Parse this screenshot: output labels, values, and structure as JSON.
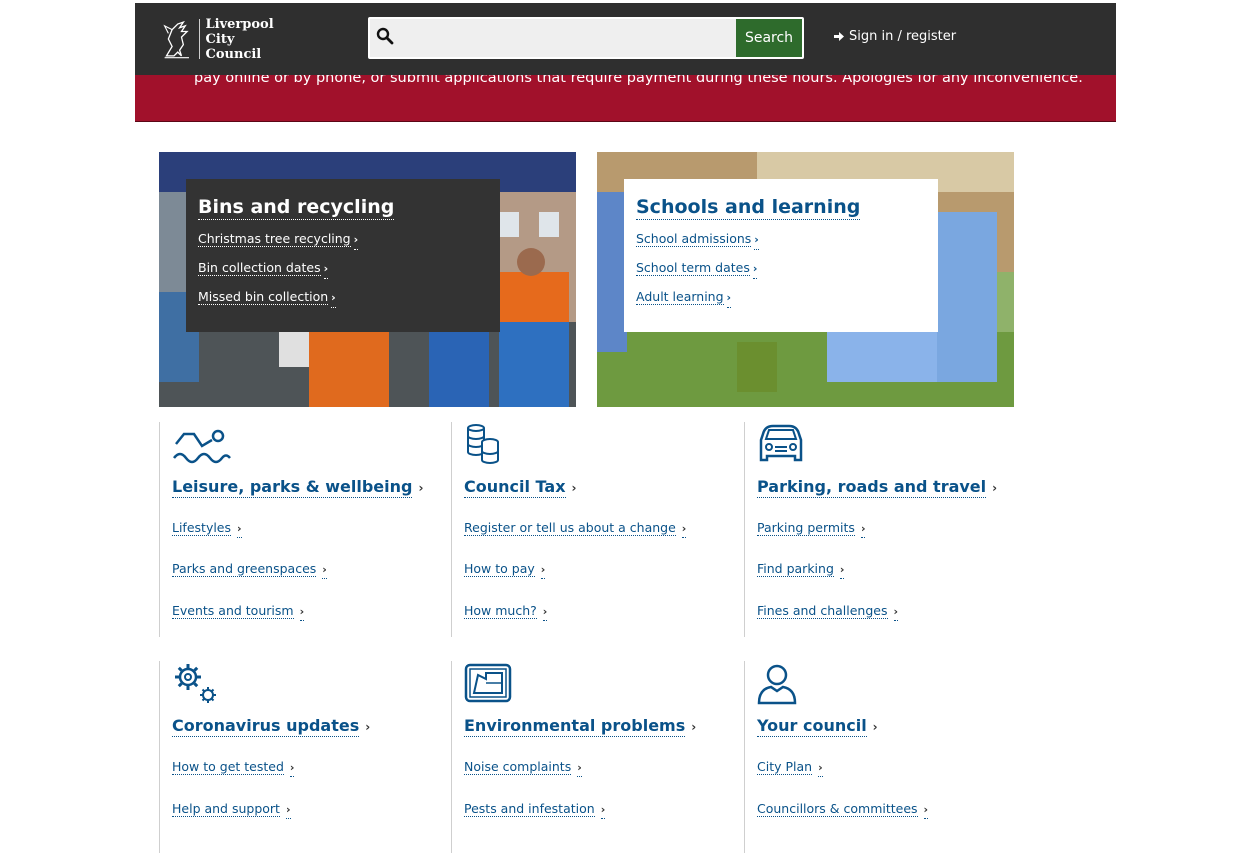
{
  "header": {
    "logo_line1": "Liverpool",
    "logo_line2": "City Council",
    "search_placeholder": "",
    "search_button": "Search",
    "signin_label": "Sign in / register"
  },
  "alert": {
    "text": "pay online or by phone, or submit applications that require payment during these hours. Apologies for any inconvenience."
  },
  "features": {
    "bins": {
      "title": "Bins and recycling",
      "links": [
        "Christmas tree recycling",
        "Bin collection dates",
        "Missed bin collection"
      ]
    },
    "schools": {
      "title": "Schools and learning",
      "links": [
        "School admissions",
        "School term dates",
        "Adult learning"
      ]
    }
  },
  "categories": [
    {
      "title": "Leisure, parks & wellbeing",
      "icon": "swimmer-icon",
      "links": [
        "Lifestyles",
        "Parks and greenspaces",
        "Events and tourism"
      ]
    },
    {
      "title": "Council Tax",
      "icon": "coins-icon",
      "links": [
        "Register or tell us about a change",
        "How to pay",
        "How much?"
      ]
    },
    {
      "title": "Parking, roads and travel",
      "icon": "car-icon",
      "links": [
        "Parking permits",
        "Find parking",
        "Fines and challenges"
      ]
    },
    {
      "title": "Coronavirus updates",
      "icon": "gears-icon",
      "links": [
        "How to get tested",
        "Help and support"
      ]
    },
    {
      "title": "Environmental problems",
      "icon": "environment-icon",
      "links": [
        "Noise complaints",
        "Pests and infestation"
      ]
    },
    {
      "title": "Your council",
      "icon": "person-icon",
      "links": [
        "City Plan",
        "Councillors & committees"
      ]
    }
  ],
  "colors": {
    "header_bg": "#2f2f2f",
    "alert_bg": "#a1112b",
    "search_button_bg": "#2e6b2c",
    "link_blue": "#0a5289"
  }
}
